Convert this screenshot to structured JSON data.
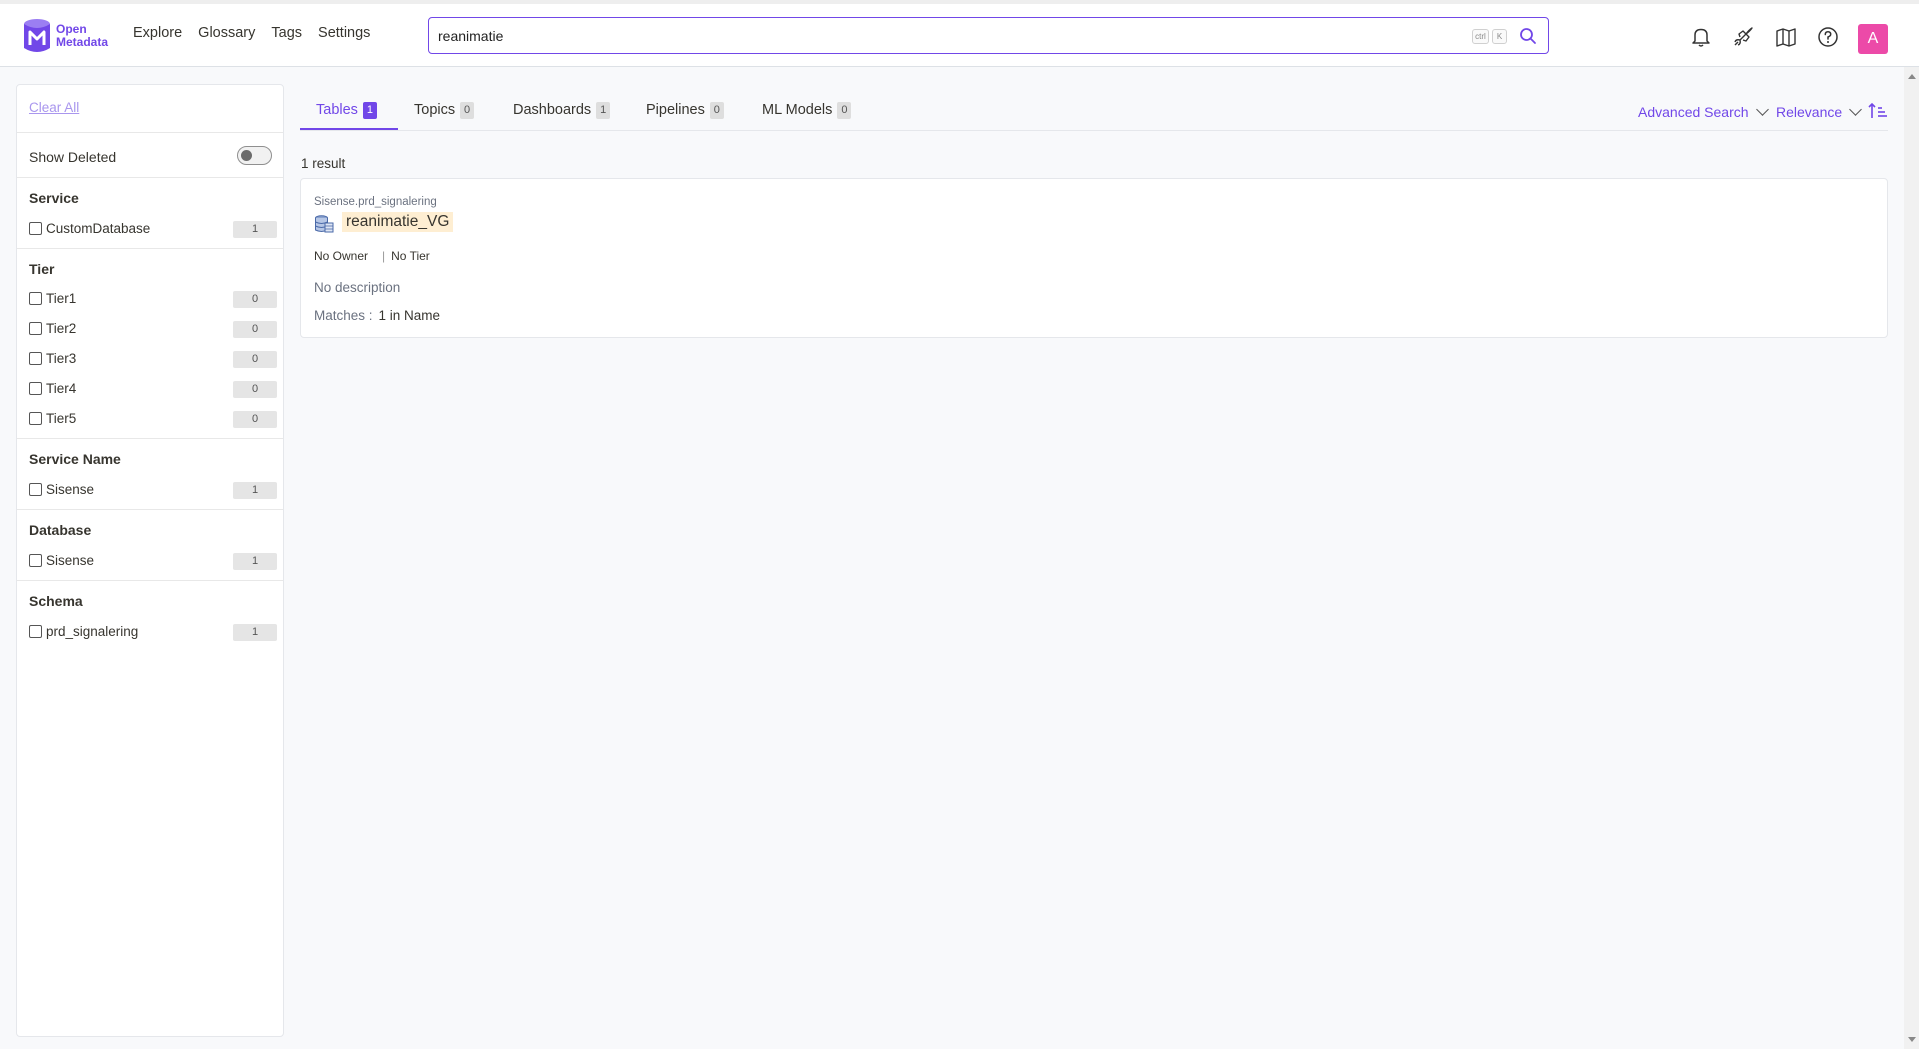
{
  "app": {
    "logo_line1": "Open",
    "logo_line2": "Metadata",
    "nav": [
      "Explore",
      "Glossary",
      "Tags",
      "Settings"
    ],
    "search_value": "reanimatie",
    "kbd_ctrl": "ctrl",
    "kbd_k": "K",
    "avatar_initial": "A",
    "accent": "#7147e8"
  },
  "sidebar": {
    "clear_all": "Clear All",
    "show_deleted": "Show Deleted",
    "groups": [
      {
        "title": "Service",
        "items": [
          {
            "label": "CustomDatabase",
            "count": "1"
          }
        ]
      },
      {
        "title": "Tier",
        "items": [
          {
            "label": "Tier1",
            "count": "0"
          },
          {
            "label": "Tier2",
            "count": "0"
          },
          {
            "label": "Tier3",
            "count": "0"
          },
          {
            "label": "Tier4",
            "count": "0"
          },
          {
            "label": "Tier5",
            "count": "0"
          }
        ]
      },
      {
        "title": "Service Name",
        "items": [
          {
            "label": "Sisense",
            "count": "1"
          }
        ]
      },
      {
        "title": "Database",
        "items": [
          {
            "label": "Sisense",
            "count": "1"
          }
        ]
      },
      {
        "title": "Schema",
        "items": [
          {
            "label": "prd_signalering",
            "count": "1"
          }
        ]
      }
    ]
  },
  "tabs": [
    {
      "label": "Tables",
      "count": "1"
    },
    {
      "label": "Topics",
      "count": "0"
    },
    {
      "label": "Dashboards",
      "count": "1"
    },
    {
      "label": "Pipelines",
      "count": "0"
    },
    {
      "label": "ML Models",
      "count": "0"
    }
  ],
  "controls": {
    "advanced_search": "Advanced Search",
    "relevance": "Relevance"
  },
  "results": {
    "count_text": "1 result",
    "items": [
      {
        "breadcrumb": "Sisense.prd_signalering",
        "name": "reanimatie_VG",
        "owner": "No Owner",
        "tier": "No Tier",
        "description": "No description",
        "matches_label": "Matches :",
        "matches_value": "1 in Name"
      }
    ]
  }
}
